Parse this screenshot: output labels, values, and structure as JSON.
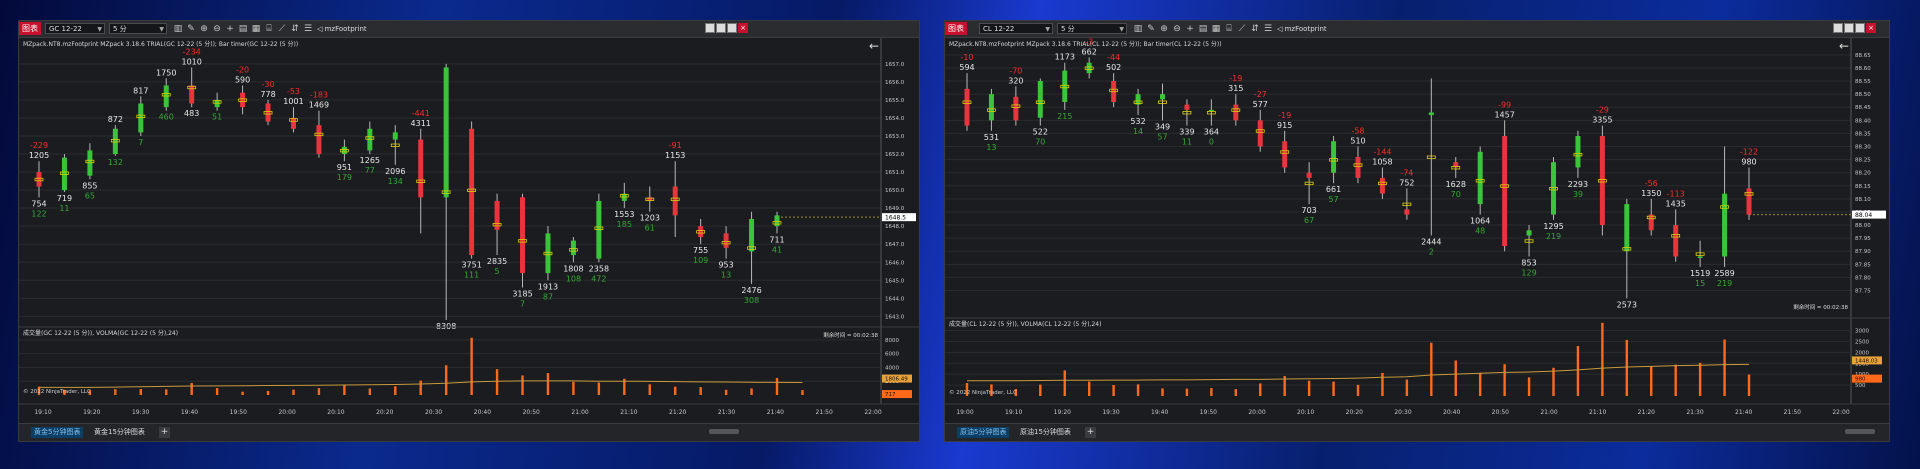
{
  "windows": [
    {
      "id": "gold",
      "title_badge": "图表",
      "instrument": "GC 12-22",
      "interval": "5 分",
      "indicator_name": "mzFootprint",
      "window_buttons": [
        "–",
        "□",
        "×"
      ],
      "price_header": "MZpack.NT8.mzFootprint MZpack 3.18.6 TRIAL(GC 12-22 (5 分)); Bar timer(GC 12-22 (5 分))",
      "volume_header": "成交量(GC 12-22 (5 分)), VOLMA(GC 12-22 (5 分),24)",
      "price_axis": [
        "1657.0",
        "1656.0",
        "1655.0",
        "1654.0",
        "1653.0",
        "1652.0",
        "1651.0",
        "1650.0",
        "1649.0",
        "1648.0",
        "1647.0",
        "1646.0",
        "1645.0",
        "1644.0",
        "1643.0"
      ],
      "price_range": [
        1642.3,
        1657.6
      ],
      "last_price": "1648.5",
      "bar_timer": "剩余时间 = 00:02:38",
      "volume_axis": [
        "8000",
        "6000",
        "4000",
        "2000"
      ],
      "volume_range": [
        0,
        9000
      ],
      "volume_tags": [
        "1806.49",
        "717"
      ],
      "copyright": "© 2022 NinjaTrader, LLC",
      "time_axis": [
        "19:10",
        "19:20",
        "19:30",
        "19:40",
        "19:50",
        "20:00",
        "20:10",
        "20:20",
        "20:30",
        "20:40",
        "20:50",
        "21:00",
        "21:10",
        "21:20",
        "21:30",
        "21:40",
        "21:50",
        "22:00"
      ],
      "tabs": [
        {
          "label": "黄金5分钟图表",
          "active": true
        },
        {
          "label": "黄金15分钟图表",
          "active": false
        }
      ],
      "candles": [
        {
          "o": 1651.0,
          "h": 1651.6,
          "l": 1649.6,
          "c": 1650.2,
          "delta": "-229",
          "vol": "1205",
          "vl": "754",
          "dl": "122"
        },
        {
          "o": 1650.0,
          "h": 1652.0,
          "l": 1649.9,
          "c": 1651.8,
          "delta": "",
          "vol": "",
          "vl": "719",
          "dl": "11"
        },
        {
          "o": 1650.8,
          "h": 1652.6,
          "l": 1650.6,
          "c": 1652.2,
          "delta": "",
          "vol": "",
          "vl": "855",
          "dl": "65"
        },
        {
          "o": 1652.0,
          "h": 1653.6,
          "l": 1651.9,
          "c": 1653.4,
          "delta": "",
          "vol": "872",
          "vl": "",
          "dl": "132"
        },
        {
          "o": 1653.2,
          "h": 1655.2,
          "l": 1653.0,
          "c": 1654.8,
          "delta": "",
          "vol": "817",
          "vl": "",
          "dl": "7"
        },
        {
          "o": 1654.6,
          "h": 1656.2,
          "l": 1654.4,
          "c": 1655.8,
          "delta": "",
          "vol": "1750",
          "vl": "",
          "dl": "460"
        },
        {
          "o": 1655.8,
          "h": 1656.8,
          "l": 1654.6,
          "c": 1654.8,
          "delta": "-234",
          "vol": "1010",
          "vl": "483",
          "dl": ""
        },
        {
          "o": 1654.6,
          "h": 1655.4,
          "l": 1654.4,
          "c": 1655.0,
          "delta": "",
          "vol": "",
          "vl": "",
          "dl": "51"
        },
        {
          "o": 1655.4,
          "h": 1655.8,
          "l": 1654.2,
          "c": 1654.6,
          "delta": "-20",
          "vol": "590",
          "vl": "",
          "dl": ""
        },
        {
          "o": 1654.8,
          "h": 1655.0,
          "l": 1653.6,
          "c": 1653.8,
          "delta": "-30",
          "vol": "778",
          "vl": "",
          "dl": ""
        },
        {
          "o": 1654.0,
          "h": 1654.6,
          "l": 1653.2,
          "c": 1653.4,
          "delta": "-53",
          "vol": "1001",
          "vl": "",
          "dl": ""
        },
        {
          "o": 1653.6,
          "h": 1654.4,
          "l": 1651.8,
          "c": 1652.0,
          "delta": "-183",
          "vol": "1469",
          "vl": "",
          "dl": ""
        },
        {
          "o": 1652.0,
          "h": 1652.8,
          "l": 1651.6,
          "c": 1652.4,
          "delta": "",
          "vol": "",
          "vl": "951",
          "dl": "179"
        },
        {
          "o": 1652.2,
          "h": 1653.8,
          "l": 1652.0,
          "c": 1653.4,
          "delta": "",
          "vol": "",
          "vl": "1265",
          "dl": "77"
        },
        {
          "o": 1652.8,
          "h": 1653.6,
          "l": 1651.4,
          "c": 1653.2,
          "delta": "",
          "vol": "",
          "vl": "2096",
          "dl": "134"
        },
        {
          "o": 1652.8,
          "h": 1653.4,
          "l": 1647.6,
          "c": 1649.6,
          "delta": "-441",
          "vol": "4311",
          "vl": "",
          "dl": ""
        },
        {
          "o": 1649.6,
          "h": 1657.0,
          "l": 1642.8,
          "c": 1656.8,
          "delta": "",
          "vol": "",
          "vl": "8308",
          "dl": ""
        },
        {
          "o": 1653.4,
          "h": 1653.8,
          "l": 1646.2,
          "c": 1646.4,
          "delta": "",
          "vol": "",
          "vl": "3751",
          "dl": "111"
        },
        {
          "o": 1649.4,
          "h": 1649.8,
          "l": 1646.4,
          "c": 1647.8,
          "delta": "",
          "vol": "",
          "vl": "2835",
          "dl": "5"
        },
        {
          "o": 1649.6,
          "h": 1649.8,
          "l": 1644.6,
          "c": 1645.4,
          "delta": "",
          "vol": "",
          "vl": "3185",
          "dl": "7"
        },
        {
          "o": 1645.4,
          "h": 1648.0,
          "l": 1645.0,
          "c": 1647.6,
          "delta": "",
          "vol": "",
          "vl": "1913",
          "dl": "87"
        },
        {
          "o": 1646.4,
          "h": 1647.4,
          "l": 1646.0,
          "c": 1647.2,
          "delta": "",
          "vol": "",
          "vl": "1808",
          "dl": "108"
        },
        {
          "o": 1646.2,
          "h": 1649.8,
          "l": 1646.0,
          "c": 1649.4,
          "delta": "",
          "vol": "",
          "vl": "2358",
          "dl": "472"
        },
        {
          "o": 1649.4,
          "h": 1650.4,
          "l": 1649.0,
          "c": 1649.8,
          "delta": "",
          "vol": "",
          "vl": "1553",
          "dl": "185"
        },
        {
          "o": 1649.6,
          "h": 1650.2,
          "l": 1648.8,
          "c": 1649.4,
          "delta": "",
          "vol": "",
          "vl": "1203",
          "dl": "61"
        },
        {
          "o": 1650.2,
          "h": 1651.6,
          "l": 1647.4,
          "c": 1648.6,
          "delta": "-91",
          "vol": "1153",
          "vl": "",
          "dl": ""
        },
        {
          "o": 1648.0,
          "h": 1648.4,
          "l": 1647.0,
          "c": 1647.4,
          "delta": "",
          "vol": "",
          "vl": "755",
          "dl": "109"
        },
        {
          "o": 1647.6,
          "h": 1648.0,
          "l": 1646.2,
          "c": 1646.8,
          "delta": "",
          "vol": "",
          "vl": "953",
          "dl": "13"
        },
        {
          "o": 1646.6,
          "h": 1648.8,
          "l": 1644.8,
          "c": 1648.4,
          "delta": "",
          "vol": "",
          "vl": "2476",
          "dl": "308"
        },
        {
          "o": 1648.0,
          "h": 1648.8,
          "l": 1647.6,
          "c": 1648.6,
          "delta": "",
          "vol": "",
          "vl": "711",
          "dl": "41"
        }
      ],
      "volumes": [
        1205,
        754,
        719,
        855,
        872,
        817,
        1750,
        1010,
        483,
        590,
        778,
        1001,
        1469,
        951,
        1265,
        2096,
        4311,
        8308,
        3751,
        2835,
        3185,
        1913,
        1808,
        2358,
        1553,
        1203,
        1153,
        755,
        953,
        2476,
        711
      ],
      "volma": [
        1100,
        1100,
        1100,
        1150,
        1200,
        1250,
        1300,
        1320,
        1340,
        1380,
        1400,
        1420,
        1450,
        1480,
        1520,
        1600,
        1700,
        1900,
        2000,
        2050,
        2050,
        2050,
        2000,
        2000,
        1980,
        1950,
        1900,
        1880,
        1850,
        1830,
        1806
      ]
    },
    {
      "id": "crude",
      "title_badge": "图表",
      "instrument": "CL 12-22",
      "interval": "5 分",
      "indicator_name": "mzFootprint",
      "window_buttons": [
        "–",
        "□",
        "×"
      ],
      "price_header": "MZpack.NT8.mzFootprint MZpack 3.18.6 TRIAL(CL 12-22 (5 分)); Bar timer(CL 12-22 (5 分))",
      "volume_header": "成交量(CL 12-22 (5 分)), VOLMA(CL 12-22 (5 分),24)",
      "price_axis": [
        "88.65",
        "88.60",
        "88.55",
        "88.50",
        "88.45",
        "88.40",
        "88.35",
        "88.30",
        "88.25",
        "88.20",
        "88.15",
        "88.10",
        "88.05",
        "88.00",
        "87.95",
        "87.90",
        "87.85",
        "87.80",
        "87.75"
      ],
      "price_range": [
        87.71,
        88.68
      ],
      "last_price": "88.04",
      "bar_timer": "剩余时间 = 00:02:38",
      "volume_axis": [
        "3000",
        "2500",
        "2000",
        "1500",
        "1000",
        "500"
      ],
      "volume_range": [
        0,
        3300
      ],
      "volume_tags": [
        "1448.03",
        "980"
      ],
      "copyright": "© 2022 NinjaTrader, LLC",
      "time_axis": [
        "19:00",
        "19:10",
        "19:20",
        "19:30",
        "19:40",
        "19:50",
        "20:00",
        "20:10",
        "20:20",
        "20:30",
        "20:40",
        "20:50",
        "21:00",
        "21:10",
        "21:20",
        "21:30",
        "21:40",
        "21:50",
        "22:00"
      ],
      "tabs": [
        {
          "label": "原油5分钟图表",
          "active": true
        },
        {
          "label": "原油15分钟图表",
          "active": false
        }
      ],
      "candles": [
        {
          "o": 88.52,
          "h": 88.58,
          "l": 88.36,
          "c": 88.38,
          "delta": "-10",
          "vol": "594",
          "vl": "",
          "dl": ""
        },
        {
          "o": 88.4,
          "h": 88.52,
          "l": 88.36,
          "c": 88.5,
          "delta": "",
          "vol": "",
          "vl": "531",
          "dl": "13"
        },
        {
          "o": 88.49,
          "h": 88.53,
          "l": 88.38,
          "c": 88.4,
          "delta": "-70",
          "vol": "320",
          "vl": "",
          "dl": ""
        },
        {
          "o": 88.41,
          "h": 88.56,
          "l": 88.38,
          "c": 88.55,
          "delta": "",
          "vol": "",
          "vl": "522",
          "dl": "70"
        },
        {
          "o": 88.47,
          "h": 88.62,
          "l": 88.44,
          "c": 88.59,
          "delta": "",
          "vol": "1173",
          "vl": "",
          "dl": "215"
        },
        {
          "o": 88.58,
          "h": 88.64,
          "l": 88.56,
          "c": 88.62,
          "delta": "-3",
          "vol": "662",
          "vl": "",
          "dl": ""
        },
        {
          "o": 88.55,
          "h": 88.58,
          "l": 88.45,
          "c": 88.47,
          "delta": "-44",
          "vol": "502",
          "vl": "",
          "dl": ""
        },
        {
          "o": 88.46,
          "h": 88.52,
          "l": 88.42,
          "c": 88.5,
          "delta": "",
          "vol": "",
          "vl": "532",
          "dl": "14"
        },
        {
          "o": 88.48,
          "h": 88.54,
          "l": 88.4,
          "c": 88.5,
          "delta": "",
          "vol": "",
          "vl": "349",
          "dl": "57"
        },
        {
          "o": 88.46,
          "h": 88.48,
          "l": 88.38,
          "c": 88.44,
          "delta": "",
          "vol": "",
          "vl": "339",
          "dl": "11"
        },
        {
          "o": 88.44,
          "h": 88.48,
          "l": 88.38,
          "c": 88.44,
          "delta": "",
          "vol": "",
          "vl": "364",
          "dl": "0"
        },
        {
          "o": 88.46,
          "h": 88.5,
          "l": 88.38,
          "c": 88.4,
          "delta": "-19",
          "vol": "315",
          "vl": "",
          "dl": ""
        },
        {
          "o": 88.4,
          "h": 88.44,
          "l": 88.28,
          "c": 88.3,
          "delta": "-27",
          "vol": "577",
          "vl": "",
          "dl": ""
        },
        {
          "o": 88.32,
          "h": 88.36,
          "l": 88.2,
          "c": 88.22,
          "delta": "-19",
          "vol": "915",
          "vl": "",
          "dl": ""
        },
        {
          "o": 88.2,
          "h": 88.24,
          "l": 88.08,
          "c": 88.18,
          "delta": "",
          "vol": "",
          "vl": "703",
          "dl": "67"
        },
        {
          "o": 88.2,
          "h": 88.34,
          "l": 88.16,
          "c": 88.32,
          "delta": "",
          "vol": "",
          "vl": "661",
          "dl": "57"
        },
        {
          "o": 88.26,
          "h": 88.3,
          "l": 88.16,
          "c": 88.18,
          "delta": "-58",
          "vol": "510",
          "vl": "",
          "dl": ""
        },
        {
          "o": 88.18,
          "h": 88.22,
          "l": 88.1,
          "c": 88.12,
          "delta": "-144",
          "vol": "1058",
          "vl": "",
          "dl": ""
        },
        {
          "o": 88.06,
          "h": 88.14,
          "l": 88.02,
          "c": 88.04,
          "delta": "-74",
          "vol": "752",
          "vl": "",
          "dl": ""
        },
        {
          "o": 88.42,
          "h": 88.56,
          "l": 87.96,
          "c": 88.43,
          "delta": "",
          "vol": "",
          "vl": "2444",
          "dl": "2"
        },
        {
          "o": 88.24,
          "h": 88.26,
          "l": 88.18,
          "c": 88.22,
          "delta": "",
          "vol": "",
          "vl": "1628",
          "dl": "70"
        },
        {
          "o": 88.08,
          "h": 88.3,
          "l": 88.04,
          "c": 88.28,
          "delta": "",
          "vol": "",
          "vl": "1064",
          "dl": "48"
        },
        {
          "o": 88.34,
          "h": 88.4,
          "l": 87.9,
          "c": 87.92,
          "delta": "-99",
          "vol": "1457",
          "vl": "",
          "dl": ""
        },
        {
          "o": 87.96,
          "h": 88.0,
          "l": 87.88,
          "c": 87.98,
          "delta": "",
          "vol": "",
          "vl": "853",
          "dl": "129"
        },
        {
          "o": 88.04,
          "h": 88.26,
          "l": 88.02,
          "c": 88.24,
          "delta": "",
          "vol": "",
          "vl": "1295",
          "dl": "219"
        },
        {
          "o": 88.22,
          "h": 88.36,
          "l": 88.18,
          "c": 88.34,
          "delta": "",
          "vol": "",
          "vl": "2293",
          "dl": "39"
        },
        {
          "o": 88.34,
          "h": 88.38,
          "l": 87.96,
          "c": 88.0,
          "delta": "-29",
          "vol": "3355",
          "vl": "",
          "dl": ""
        },
        {
          "o": 87.9,
          "h": 88.1,
          "l": 87.72,
          "c": 88.08,
          "delta": "",
          "vol": "",
          "vl": "2573",
          "dl": ""
        },
        {
          "o": 88.04,
          "h": 88.1,
          "l": 87.96,
          "c": 87.98,
          "delta": "-56",
          "vol": "1350",
          "vl": "",
          "dl": ""
        },
        {
          "o": 88.0,
          "h": 88.06,
          "l": 87.86,
          "c": 87.88,
          "delta": "-113",
          "vol": "1435",
          "vl": "",
          "dl": ""
        },
        {
          "o": 87.88,
          "h": 87.94,
          "l": 87.84,
          "c": 87.88,
          "delta": "",
          "vol": "",
          "vl": "1519",
          "dl": "15"
        },
        {
          "o": 87.88,
          "h": 88.3,
          "l": 87.84,
          "c": 88.12,
          "delta": "",
          "vol": "",
          "vl": "2589",
          "dl": "219"
        },
        {
          "o": 88.14,
          "h": 88.22,
          "l": 88.02,
          "c": 88.04,
          "delta": "-122",
          "vol": "980",
          "vl": "",
          "dl": ""
        }
      ],
      "volumes": [
        594,
        531,
        320,
        522,
        1173,
        662,
        502,
        532,
        349,
        339,
        364,
        315,
        577,
        915,
        703,
        661,
        510,
        1058,
        752,
        2444,
        1628,
        1064,
        1457,
        853,
        1295,
        2293,
        3355,
        2573,
        1350,
        1435,
        1519,
        2589,
        980
      ],
      "volma": [
        700,
        700,
        700,
        710,
        720,
        720,
        730,
        730,
        740,
        740,
        750,
        760,
        760,
        780,
        790,
        800,
        820,
        860,
        880,
        960,
        1000,
        1040,
        1080,
        1100,
        1140,
        1200,
        1280,
        1330,
        1360,
        1390,
        1410,
        1440,
        1448
      ]
    }
  ]
}
